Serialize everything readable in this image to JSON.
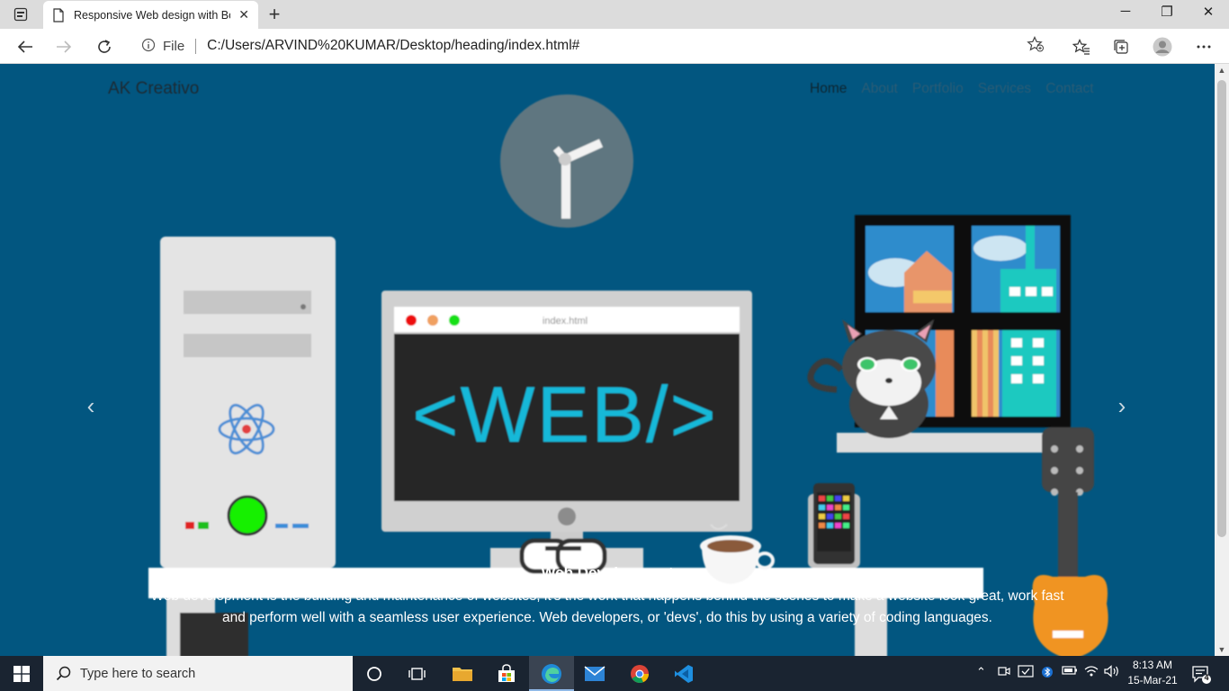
{
  "browser": {
    "tab_title": "Responsive Web design with Boo",
    "tab_close": "✕",
    "new_tab": "+",
    "address_scheme": "File",
    "address_url": "C:/Users/ARVIND%20KUMAR/Desktop/heading/index.html#",
    "window_controls": [
      "─",
      "❐",
      "✕"
    ]
  },
  "site": {
    "brand": "AK Creativo",
    "nav": [
      "Home",
      "About",
      "Portfolio",
      "Services",
      "Contact"
    ],
    "active_nav": "Home",
    "caption_title": "Web Development",
    "caption_text": "Web development is the building and maintenance of websites; it's the work that happens behind the scenes to make a website look great, work fast and perform well with a seamless user experience. Web developers, or 'devs', do this by using a variety of coding languages.",
    "screen_text": "<WEB/>",
    "window_title": "index.html",
    "prev_arrow": "‹",
    "next_arrow": "›",
    "background_color": "#025680"
  },
  "taskbar": {
    "search_placeholder": "Type here to search",
    "time": "8:13 AM",
    "date": "15-Mar-21",
    "notification_count": "4"
  }
}
